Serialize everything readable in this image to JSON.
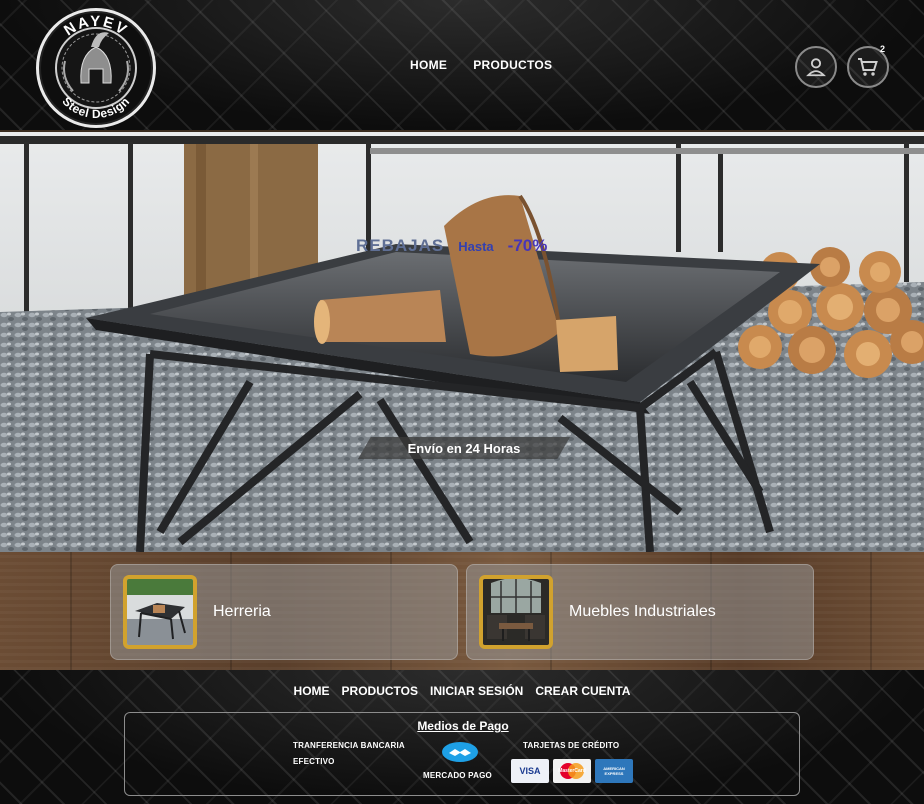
{
  "brand": {
    "name_top": "NAYEV",
    "name_bottom": "Steel Design"
  },
  "nav": {
    "home": "HOME",
    "products": "PRODUCTOS"
  },
  "header": {
    "user_icon": "user-icon",
    "cart_icon": "cart-icon",
    "cart_count": "2"
  },
  "hero": {
    "promo_word": "REBAJAS",
    "promo_until": "Hasta",
    "promo_discount": "-70%",
    "shipping_badge": "Envío en 24 Horas"
  },
  "categories": [
    {
      "label": "Herreria",
      "icon": "fire-pit-thumbnail"
    },
    {
      "label": "Muebles Industriales",
      "icon": "industrial-furniture-thumbnail"
    }
  ],
  "footer": {
    "nav": [
      "HOME",
      "PRODUCTOS",
      "INICIAR SESIÓN",
      "CREAR CUENTA"
    ],
    "payments": {
      "title": "Medios de Pago",
      "bank_transfer": "TRANFERENCIA BANCARIA",
      "cash": "EFECTIVO",
      "mercado_pago": "MERCADO PAGO",
      "credit_cards": "TARJETAS DE CRÉDITO",
      "visa": "VISA",
      "mastercard": "MasterCard",
      "amex": "AMERICAN EXPRESS"
    }
  },
  "colors": {
    "accent_gold": "#d1a22e",
    "promo_blue": "#3340b0",
    "wood": "#6b4c34"
  }
}
